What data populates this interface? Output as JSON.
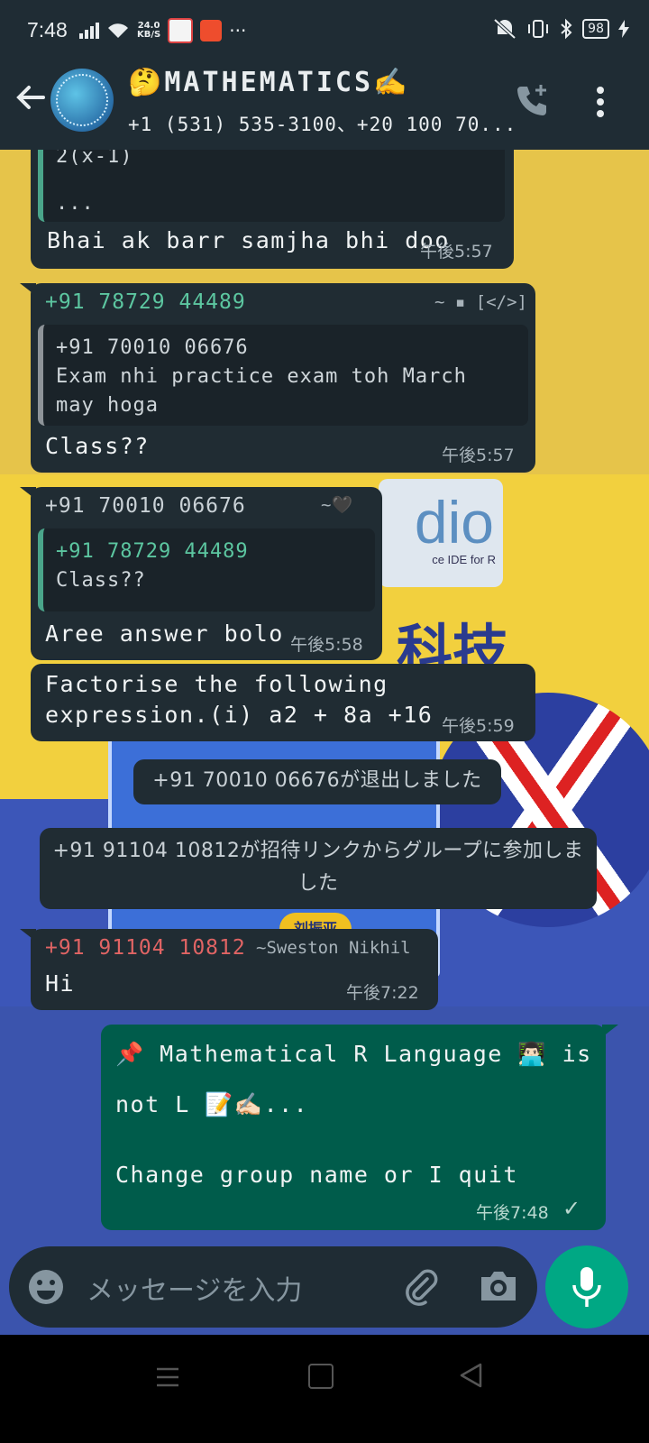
{
  "status_bar": {
    "time": "7:48",
    "net_speed_value": "24.0",
    "net_speed_unit": "KB/S",
    "more": "···",
    "battery": "98"
  },
  "header": {
    "title": "🤔MATHEMATICS✍️",
    "subtitle": "+1 (531) 535-3100、+20 100 70..."
  },
  "messages": [
    {
      "quote_fragment_top": "2(x-1)",
      "quote_ellipsis": "...",
      "text": "Bhai ak barr samjha bhi doo",
      "time": "午後5:57"
    },
    {
      "sender": "+91 78729 44489",
      "alias": "~ ▪ [</>]",
      "quote_sender": "+91 70010 06676",
      "quote_text": "Exam nhi practice exam toh March may hoga",
      "text": "Class??",
      "time": "午後5:57"
    },
    {
      "sender": "+91 70010 06676",
      "alias": "~🖤",
      "quote_sender": "+91 78729 44489",
      "quote_text": "Class??",
      "text": "Aree answer bolo",
      "time": "午後5:58"
    },
    {
      "text": "Factorise the following expression.(i) a2 + 8a +16",
      "time": "午後5:59"
    },
    {
      "sender": "+91 91104 10812",
      "alias": "~Sweston Nikhil",
      "text": "Hi",
      "time": "午後7:22"
    }
  ],
  "system_messages": [
    "+91 70010 06676が退出しました",
    "+91 91104 10812が招待リンクからグループに参加しました"
  ],
  "outgoing": {
    "line1": "📌 Mathematical R Language 👨🏻‍💻 is",
    "line2": "not L 📝✍🏻...",
    "line3": "Change group name or I quit",
    "time": "午後7:48",
    "tick": "✓"
  },
  "wallpaper": {
    "rstudio_text": "dio",
    "rstudio_sub": "ce IDE for R",
    "kanji": "科技",
    "name_tag": "刘振亚"
  },
  "input": {
    "placeholder": "メッセージを入力"
  },
  "colors": {
    "header": "#1f2c34",
    "incoming": "#202c33",
    "outgoing": "#005c4b",
    "accent": "#00a884"
  }
}
